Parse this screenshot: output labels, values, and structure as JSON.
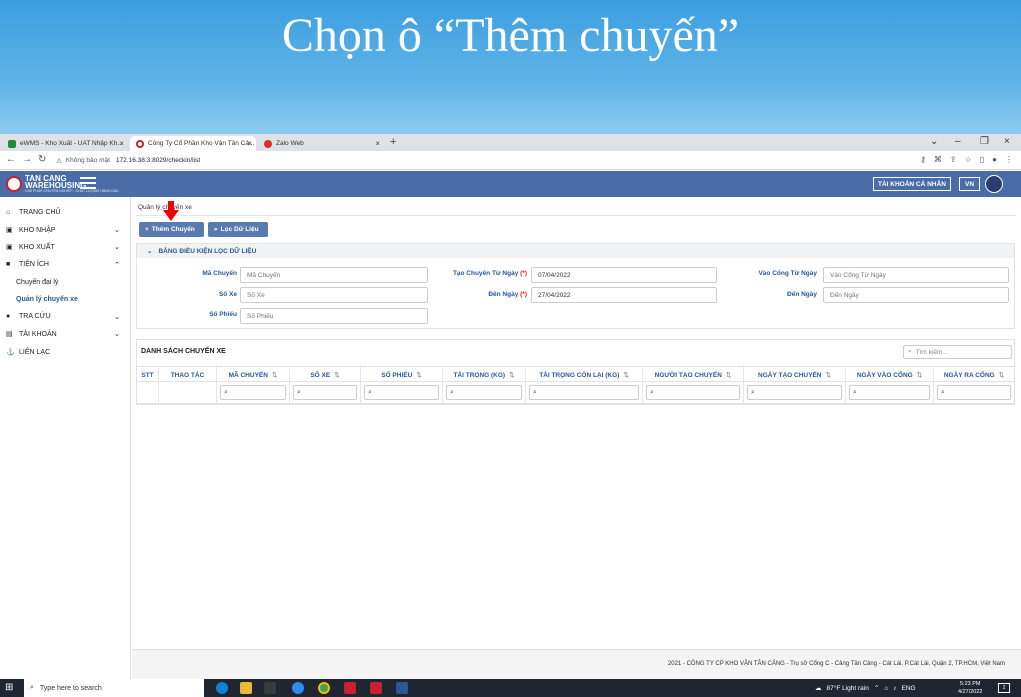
{
  "slide": {
    "title": "Chọn ô “Thêm chuyến”"
  },
  "browser": {
    "tabs": [
      {
        "label": "eWMS - Kho Xuất - UAT Nhập Kh...",
        "color": "#1e8e3e"
      },
      {
        "label": "Công Ty Cổ Phần Kho Vận Tân Cả...",
        "color": "#c8202e"
      },
      {
        "label": "Zalo Web",
        "color": "#d93025"
      }
    ],
    "security_label": "Không bảo mật",
    "url": "172.16.38.3:8029/checkin/list"
  },
  "header": {
    "logo_title": "TAN CANG",
    "logo_subtitle": "WAREHOUSING",
    "logo_tagline": "GIẢI PHÁP CHUYÊN NGHIỆP - CHẤT LƯỢNG HÀNG ĐẦU",
    "account_label": "TÀI KHOẢN CÁ NHÂN",
    "lang_label": "VN"
  },
  "sidebar": {
    "items": [
      {
        "label": "TRANG CHỦ",
        "icon": "home-icon"
      },
      {
        "label": "KHO NHẬP",
        "icon": "cart-icon"
      },
      {
        "label": "KHO XUẤT",
        "icon": "cart-icon"
      },
      {
        "label": "TIỆN ÍCH",
        "icon": "briefcase-icon"
      },
      {
        "label": "TRA CỨU",
        "icon": "globe-icon"
      },
      {
        "label": "TÀI KHOẢN",
        "icon": "id-card-icon"
      },
      {
        "label": "LIÊN LẠC",
        "icon": "anchor-icon"
      }
    ],
    "submenu": [
      {
        "label": "Chuyến đại lý"
      },
      {
        "label": "Quản lý chuyến xe"
      }
    ]
  },
  "main": {
    "breadcrumb": "Quản lý chuyến xe",
    "add_button": "Thêm Chuyến",
    "filter_button": "Lọc Dữ Liệu",
    "filter_title": "BẢNG ĐIỀU KIỆN LỌC DỮ LIỆU",
    "filters": {
      "ma_chuyen": {
        "label": "Mã Chuyến",
        "placeholder": "Mã Chuyến"
      },
      "so_xe": {
        "label": "Số Xe",
        "placeholder": "Số Xe"
      },
      "so_phieu": {
        "label": "Số Phiếu",
        "placeholder": "Số Phiếu"
      },
      "tu_ngay": {
        "label": "Tạo Chuyến Từ Ngày",
        "required": "(*)",
        "value": "07/04/2022"
      },
      "den_ngay": {
        "label": "Đến Ngày",
        "required": "(*)",
        "value": "27/04/2022"
      },
      "vao_cong_tu_ngay": {
        "label": "Vào Cổng Từ Ngày",
        "placeholder": "Vào Cổng Từ Ngày"
      },
      "vao_cong_den_ngay": {
        "label": "Đến Ngày",
        "placeholder": "Đến Ngày"
      }
    },
    "list_title": "DANH SÁCH CHUYẾN XE",
    "search_placeholder": "Tìm kiếm...",
    "columns": [
      "STT",
      "THAO TÁC",
      "MÃ CHUYẾN",
      "SỐ XE",
      "SỐ PHIẾU",
      "TẢI TRỌNG (KG)",
      "TẢI TRỌNG CÒN LẠI (KG)",
      "NGƯỜI TẠO CHUYẾN",
      "NGÀY TẠO CHUYẾN",
      "NGÀY VÀO CỔNG",
      "NGÀY RA CỔNG"
    ],
    "footer": "2021 - CÔNG TY CP KHO VẬN TÂN CẢNG - Trụ sở Cổng C - Cảng Tân Cảng - Cát Lái, P.Cát Lái, Quận 2, TP.HCM, Việt Nam"
  },
  "taskbar": {
    "search_placeholder": "Type here to search",
    "weather": "87°F  Light rain",
    "lang": "ENG",
    "time": "5:23 PM",
    "date": "4/27/2022",
    "notifications": "2"
  }
}
